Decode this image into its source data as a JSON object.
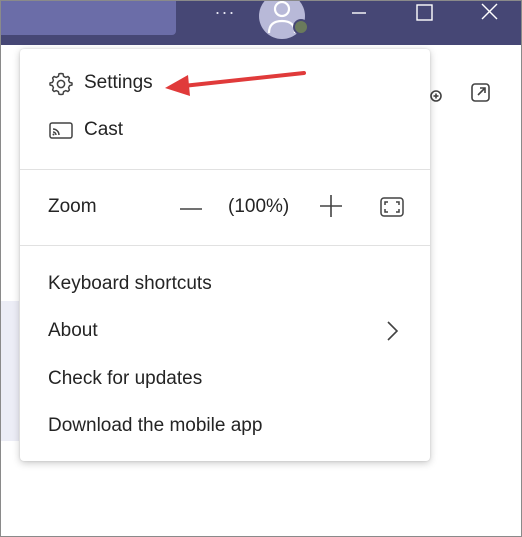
{
  "titlebar": {
    "more_glyph": "···",
    "icons": [
      "more-icon",
      "avatar",
      "minimize-icon",
      "maximize-icon",
      "close-icon"
    ]
  },
  "menu": {
    "settings_label": "Settings",
    "cast_label": "Cast",
    "zoom_label": "Zoom",
    "zoom_value": "(100%)",
    "keyboard_shortcuts_label": "Keyboard shortcuts",
    "about_label": "About",
    "check_updates_label": "Check for updates",
    "download_mobile_label": "Download the mobile app"
  },
  "colors": {
    "titlebar": "#464775",
    "search_area": "#6b6da8",
    "annotation_arrow": "#e03a3a"
  }
}
